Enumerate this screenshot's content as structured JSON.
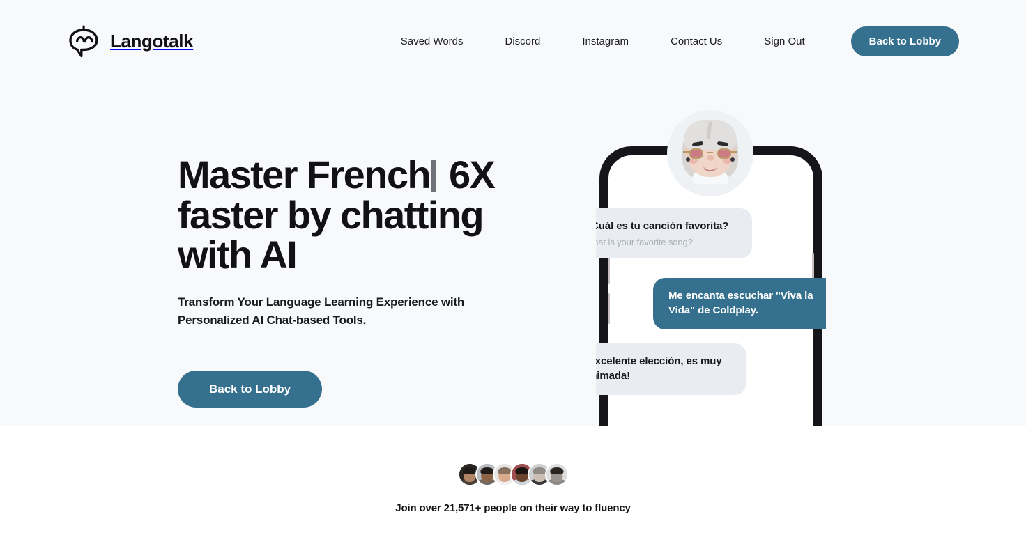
{
  "brand": {
    "name": "Langotalk",
    "icon": "chatbot-logo-icon"
  },
  "header": {
    "nav_links": [
      {
        "label": "Saved Words",
        "name": "nav-saved-words"
      },
      {
        "label": "Discord",
        "name": "nav-discord"
      },
      {
        "label": "Instagram",
        "name": "nav-instagram"
      },
      {
        "label": "Contact Us",
        "name": "nav-contact-us"
      },
      {
        "label": "Sign Out",
        "name": "nav-sign-out"
      }
    ],
    "cta_label": "Back to Lobby"
  },
  "hero": {
    "headline_part1": "Master French",
    "headline_part2": " 6X faster by chatting with AI",
    "subhead": "Transform Your Language Learning Experience with Personalized AI Chat-based Tools.",
    "cta_label": "Back to Lobby"
  },
  "phone": {
    "avatar_name": "elderly-woman-avatar",
    "messages": [
      {
        "side": "incoming",
        "text": "¿Cuál es tu canción favorita?",
        "translation": "What is your favorite song?"
      },
      {
        "side": "outgoing",
        "text": "Me encanta escuchar \"Viva la Vida\" de Coldplay.",
        "translation": ""
      },
      {
        "side": "incoming",
        "text": "¡Excelente elección, es muy animada!",
        "translation": ""
      }
    ]
  },
  "social_proof": {
    "text": "Join over 21,571+ people on their way to fluency",
    "avatars": [
      {
        "name": "user-avatar-1",
        "bg": "#2b2722",
        "skin": "#b08464",
        "hair": "#1d1a17",
        "body": "#4a4038"
      },
      {
        "name": "user-avatar-2",
        "bg": "#b9bcc0",
        "skin": "#8d6446",
        "hair": "#241c17",
        "body": "#6f6a66"
      },
      {
        "name": "user-avatar-3",
        "bg": "#e7e5e3",
        "skin": "#d9ab8c",
        "hair": "#8a7260",
        "body": "#f0efee"
      },
      {
        "name": "user-avatar-4",
        "bg": "#9f4e52",
        "skin": "#6b4430",
        "hair": "#1b1411",
        "body": "#cfd8de"
      },
      {
        "name": "user-avatar-5",
        "bg": "#cfcfcf",
        "skin": "#cbbfb5",
        "hair": "#8f8a86",
        "body": "#3c3a39"
      },
      {
        "name": "user-avatar-6",
        "bg": "#dedede",
        "skin": "#9a948f",
        "hair": "#2a2522",
        "body": "#8b8785"
      }
    ]
  },
  "colors": {
    "accent": "#35708f",
    "hero_background": "#f8f9fb",
    "bubble_incoming": "#e9edf1",
    "text_primary": "#121214",
    "translation_text": "#a7aeb8"
  }
}
